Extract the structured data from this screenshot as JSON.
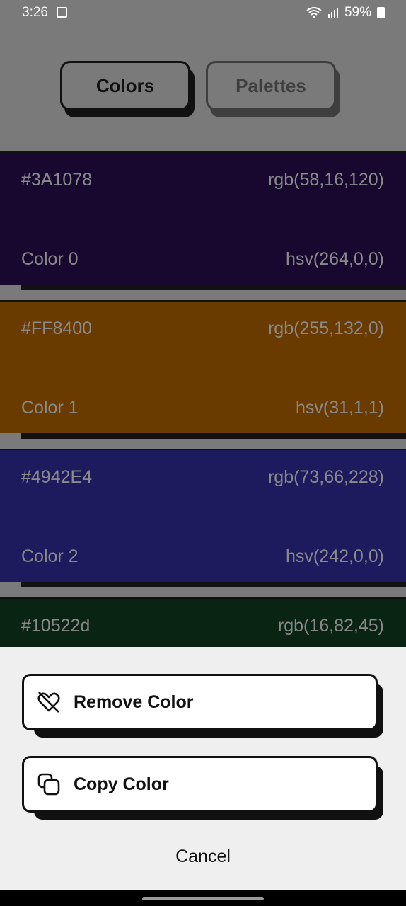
{
  "status": {
    "time": "3:26",
    "battery": "59%"
  },
  "tabs": [
    {
      "label": "Colors",
      "active": true
    },
    {
      "label": "Palettes",
      "active": false
    }
  ],
  "colors": [
    {
      "hex": "#3A1078",
      "rgb": "rgb(58,16,120)",
      "name": "Color 0",
      "hsv": "hsv(264,0,0)",
      "bg": "#180830"
    },
    {
      "hex": "#FF8400",
      "rgb": "rgb(255,132,0)",
      "name": "Color 1",
      "hsv": "hsv(31,1,1)",
      "bg": "#6a3b00"
    },
    {
      "hex": "#4942E4",
      "rgb": "rgb(73,66,228)",
      "name": "Color 2",
      "hsv": "hsv(242,0,0)",
      "bg": "#1d1b5e"
    },
    {
      "hex": "#10522d",
      "rgb": "rgb(16,82,45)",
      "bg": "#0a2414"
    }
  ],
  "sheet": {
    "remove_label": "Remove Color",
    "copy_label": "Copy Color",
    "cancel_label": "Cancel"
  }
}
